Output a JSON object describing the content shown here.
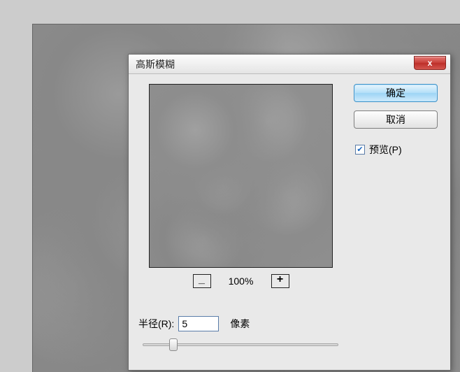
{
  "dialog": {
    "title": "高斯模糊",
    "zoom": {
      "out_label": "_",
      "in_label": "+",
      "level": "100%"
    },
    "radius": {
      "label": "半径(R):",
      "value": "5",
      "unit": "像素"
    },
    "buttons": {
      "ok": "确定",
      "cancel": "取消"
    },
    "preview_checkbox": {
      "label": "预览(P)",
      "checked": true
    },
    "close_glyph": "x"
  }
}
